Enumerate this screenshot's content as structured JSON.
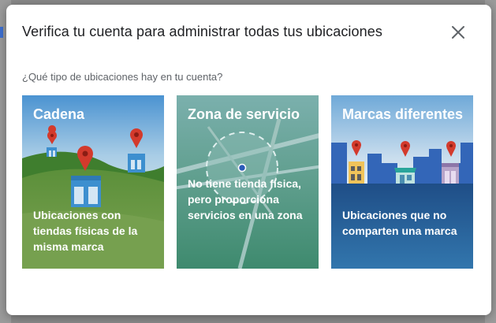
{
  "dialog": {
    "title": "Verifica tu cuenta para administrar todas tus ubicaciones",
    "close_icon": "close-icon",
    "question": "¿Qué tipo de ubicaciones hay en tu cuenta?"
  },
  "cards": [
    {
      "title": "Cadena",
      "description": "Ubicaciones con tiendas físicas de la misma marca",
      "color": "#76a04f"
    },
    {
      "title": "Zona de servicio",
      "description": "No tiene tienda física, pero proporciona servicios en una zona",
      "color": "#4b9280"
    },
    {
      "title": "Marcas diferentes",
      "description": "Ubicaciones que no comparten una marca",
      "color": "#2a6aa3"
    }
  ]
}
